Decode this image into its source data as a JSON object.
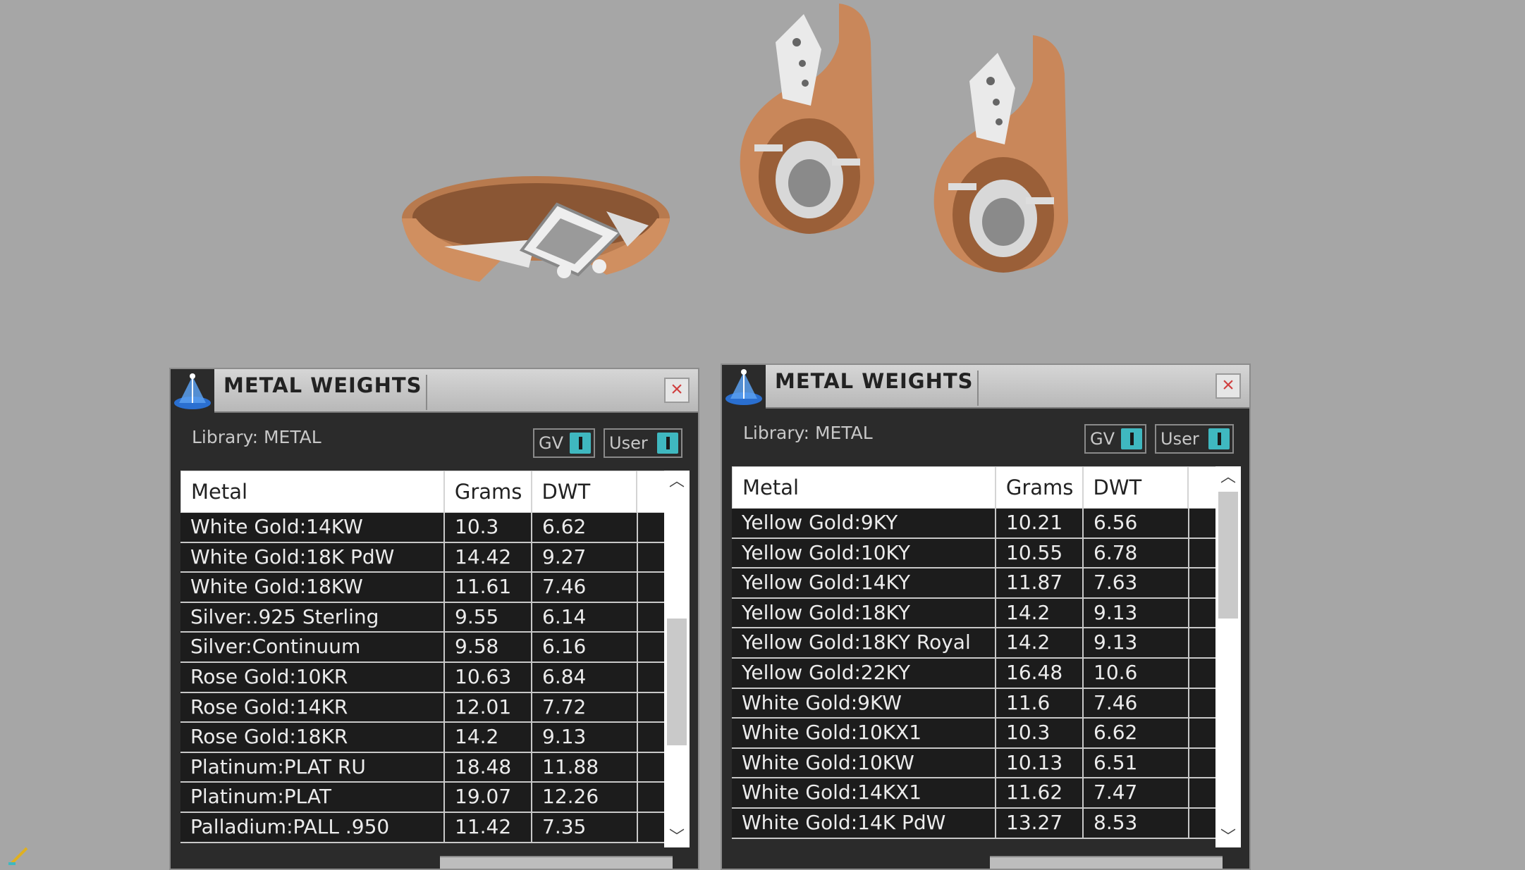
{
  "panels": [
    {
      "title": "METAL WEIGHTS",
      "library_label": "Library: METAL",
      "toggle_gv": "GV",
      "toggle_user": "User",
      "columns": [
        "Metal",
        "Grams",
        "DWT"
      ],
      "rows": [
        [
          "White Gold:14KW",
          "10.3",
          "6.62"
        ],
        [
          "White Gold:18K PdW",
          "14.42",
          "9.27"
        ],
        [
          "White Gold:18KW",
          "11.61",
          "7.46"
        ],
        [
          "Silver:.925 Sterling",
          "9.55",
          "6.14"
        ],
        [
          "Silver:Continuum",
          "9.58",
          "6.16"
        ],
        [
          "Rose Gold:10KR",
          "10.63",
          "6.84"
        ],
        [
          "Rose Gold:14KR",
          "12.01",
          "7.72"
        ],
        [
          "Rose Gold:18KR",
          "14.2",
          "9.13"
        ],
        [
          "Platinum:PLAT RU",
          "18.48",
          "11.88"
        ],
        [
          "Platinum:PLAT",
          "19.07",
          "12.26"
        ],
        [
          "Palladium:PALL .950",
          "11.42",
          "7.35"
        ]
      ]
    },
    {
      "title": "METAL WEIGHTS",
      "library_label": "Library: METAL",
      "toggle_gv": "GV",
      "toggle_user": "User",
      "columns": [
        "Metal",
        "Grams",
        "DWT"
      ],
      "rows": [
        [
          "Yellow Gold:9KY",
          "10.21",
          "6.56"
        ],
        [
          "Yellow Gold:10KY",
          "10.55",
          "6.78"
        ],
        [
          "Yellow Gold:14KY",
          "11.87",
          "7.63"
        ],
        [
          "Yellow Gold:18KY",
          "14.2",
          "9.13"
        ],
        [
          "Yellow Gold:18KY Royal",
          "14.2",
          "9.13"
        ],
        [
          "Yellow Gold:22KY",
          "16.48",
          "10.6"
        ],
        [
          "White Gold:9KW",
          "11.6",
          "7.46"
        ],
        [
          "White Gold:10KX1",
          "10.3",
          "6.62"
        ],
        [
          "White Gold:10KW",
          "10.13",
          "6.51"
        ],
        [
          "White Gold:14KX1",
          "11.62",
          "7.47"
        ],
        [
          "White Gold:14K PdW",
          "13.27",
          "8.53"
        ]
      ]
    }
  ],
  "colors": {
    "viewport_bg": "#a6a6a6",
    "rose_gold": "#c98a5c",
    "toggle_accent": "#3fb8c0",
    "panel_bg": "#2b2b2b"
  },
  "icons": {
    "panel_icon": "scale-icon",
    "close": "close-icon",
    "scroll_up": "chevron-up-icon",
    "scroll_down": "chevron-down-icon"
  }
}
